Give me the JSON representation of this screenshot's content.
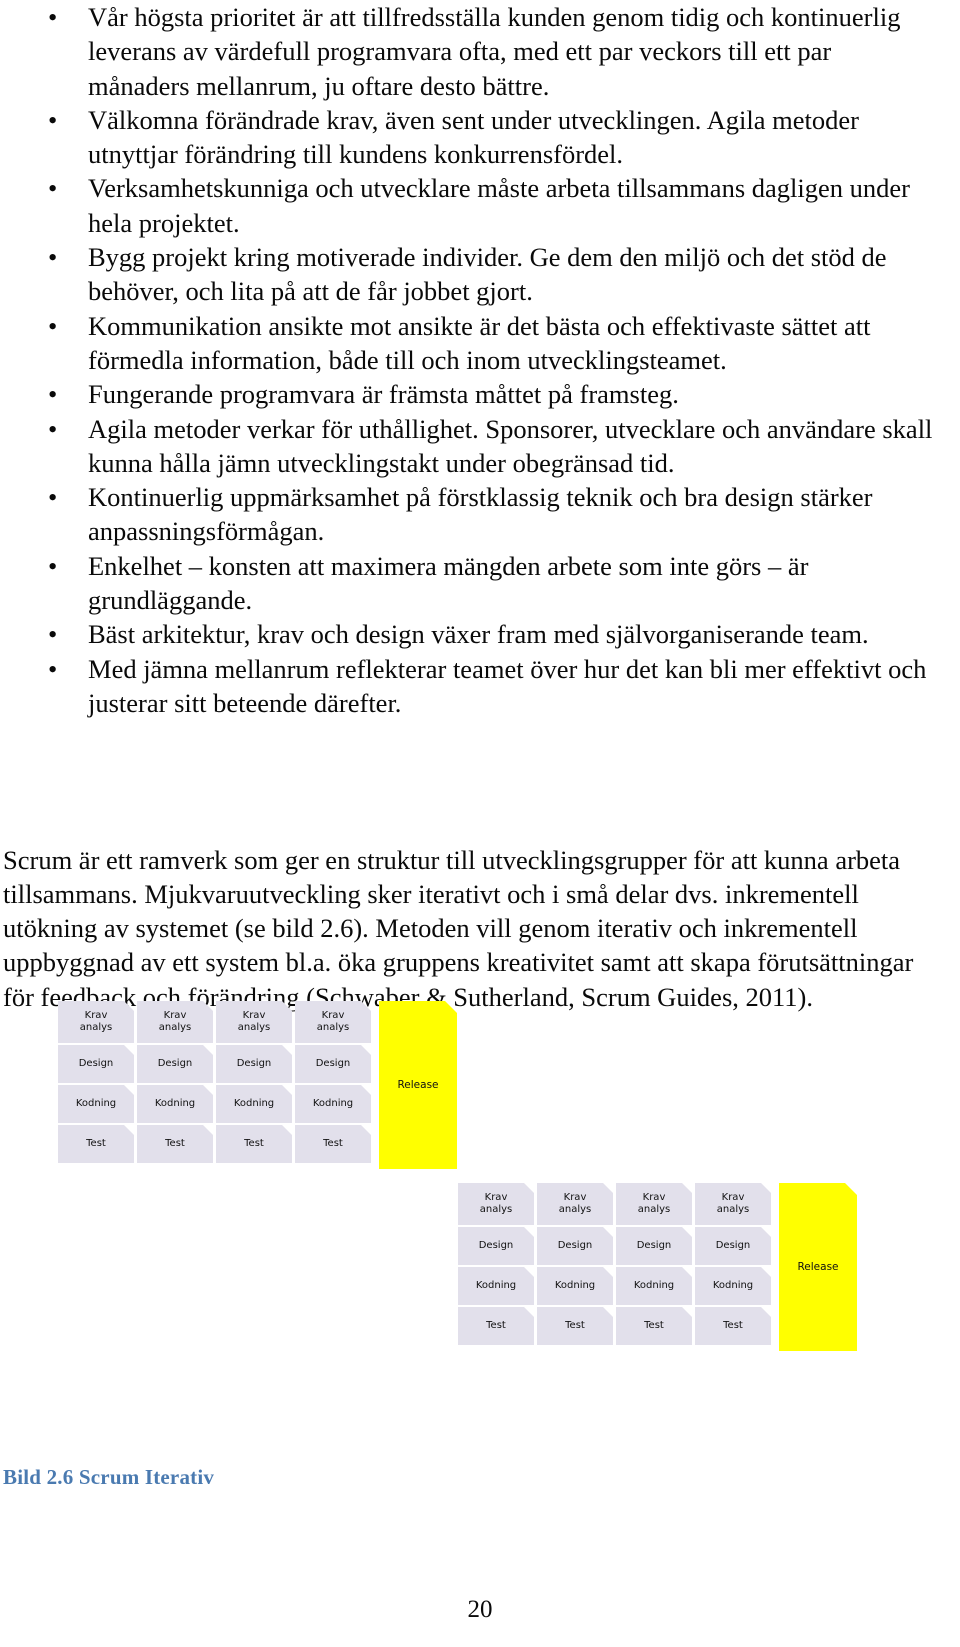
{
  "principles": {
    "bullet_glyph": "•",
    "items": [
      "Vår högsta prioritet är att tillfredsställa kunden genom tidig och kontinuerlig leverans av värdefull programvara ofta, med ett par veckors till ett par månaders mellanrum, ju oftare desto bättre.",
      "Välkomna förändrade krav, även sent under utvecklingen. Agila metoder utnyttjar förändring till kundens konkurrensfördel.",
      "Verksamhetskunniga och utvecklare måste arbeta tillsammans dagligen under hela projektet.",
      "Bygg projekt kring motiverade individer. Ge dem den miljö och det stöd de behöver, och lita på att de får jobbet gjort.",
      "Kommunikation ansikte mot ansikte är det bästa och effektivaste sättet att förmedla information, både till och inom utvecklingsteamet.",
      "Fungerande programvara är främsta måttet på framsteg.",
      "Agila metoder verkar för uthållighet. Sponsorer, utvecklare och användare skall kunna hålla jämn utvecklingstakt under obegränsad tid.",
      "Kontinuerlig uppmärksamhet på förstklassig teknik och bra design stärker anpassningsförmågan.",
      "Enkelhet – konsten att maximera mängden arbete som inte görs – är grundläggande.",
      "Bäst arkitektur, krav och design växer fram med självorganiserande team.",
      "Med jämna mellanrum reflekterar teamet över hur det kan bli mer effektivt och justerar sitt beteende därefter."
    ]
  },
  "body_paragraph": "Scrum är ett ramverk som ger en struktur till utvecklingsgrupper för att kunna arbeta tillsammans. Mjukvaruutveckling sker iterativt och i små delar dvs. inkrementell utökning av systemet (se bild 2.6). Metoden vill genom iterativ och inkrementell uppbyggnad av ett system bl.a. öka gruppens kreativitet samt att skapa förutsättningar för feedback och förändring (Schwaber & Sutherland, Scrum Guides, 2011).",
  "figure": {
    "caption": "Bild 2.6 Scrum Iterativ",
    "colors": {
      "card_fill": "#e2e0eb",
      "card_border": "#41648c",
      "release_fill": "#ffff00",
      "caption_color": "#4a7ab0"
    },
    "blocks": [
      {
        "id": "block-1",
        "sprints": [
          {
            "steps": [
              "Krav\nanalys",
              "Design",
              "Kodning",
              "Test"
            ]
          },
          {
            "steps": [
              "Krav\nanalys",
              "Design",
              "Kodning",
              "Test"
            ]
          },
          {
            "steps": [
              "Krav\nanalys",
              "Design",
              "Kodning",
              "Test"
            ]
          },
          {
            "steps": [
              "Krav\nanalys",
              "Design",
              "Kodning",
              "Test"
            ]
          }
        ],
        "release_label": "Release"
      },
      {
        "id": "block-2",
        "sprints": [
          {
            "steps": [
              "Krav\nanalys",
              "Design",
              "Kodning",
              "Test"
            ]
          },
          {
            "steps": [
              "Krav\nanalys",
              "Design",
              "Kodning",
              "Test"
            ]
          },
          {
            "steps": [
              "Krav\nanalys",
              "Design",
              "Kodning",
              "Test"
            ]
          },
          {
            "steps": [
              "Krav\nanalys",
              "Design",
              "Kodning",
              "Test"
            ]
          }
        ],
        "release_label": "Release"
      }
    ],
    "step_labels": {
      "krav_line1": "Krav",
      "krav_line2": "analys",
      "design": "Design",
      "kodning": "Kodning",
      "test": "Test"
    }
  },
  "footer": {
    "page_number": "20"
  }
}
